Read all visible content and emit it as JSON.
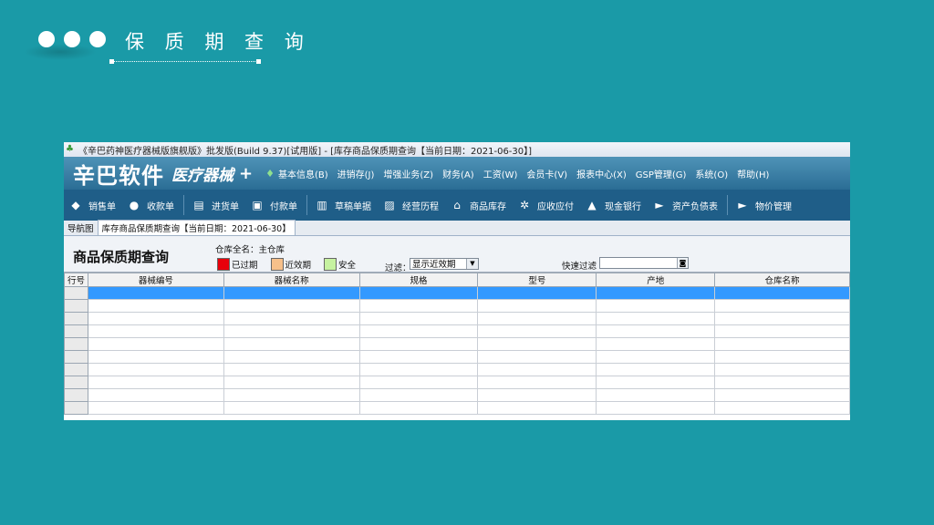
{
  "slide": {
    "title": "保 质 期 查 询"
  },
  "window": {
    "title": "《辛巴药神医疗器械版旗舰版》批发版(Build 9.37)[试用版] - [库存商品保质期查询【当前日期：2021-06-30】]"
  },
  "brand": {
    "logo": "辛巴软件",
    "subtitle": "医疗器械",
    "plus": "+"
  },
  "menu": [
    "基本信息(B)",
    "进销存(J)",
    "增强业务(Z)",
    "财务(A)",
    "工资(W)",
    "会员卡(V)",
    "报表中心(X)",
    "GSP管理(G)",
    "系统(O)",
    "帮助(H)"
  ],
  "toolbar": {
    "items": [
      {
        "label": "销售单",
        "icon": "tag-icon"
      },
      {
        "label": "收款单",
        "icon": "receipt-icon"
      },
      {
        "label": "进货单",
        "icon": "clipboard-icon"
      },
      {
        "label": "付款单",
        "icon": "payment-icon"
      },
      {
        "label": "草稿单据",
        "icon": "draft-icon"
      },
      {
        "label": "经营历程",
        "icon": "chart-icon"
      },
      {
        "label": "商品库存",
        "icon": "warehouse-icon"
      },
      {
        "label": "应收应付",
        "icon": "gears-icon"
      },
      {
        "label": "现金银行",
        "icon": "bank-icon"
      },
      {
        "label": "资产负债表",
        "icon": "truck-icon"
      },
      {
        "label": "物价管理",
        "icon": "price-icon"
      }
    ]
  },
  "tabs": [
    {
      "label": "导航图",
      "active": false
    },
    {
      "label": "库存商品保质期查询【当前日期：2021-06-30】",
      "active": true
    }
  ],
  "filters": {
    "heading": "商品保质期查询",
    "warehouse": "仓库全名：主仓库",
    "legend": [
      {
        "label": "已过期",
        "color": "#e8000b"
      },
      {
        "label": "近效期",
        "color": "#f7c08a"
      },
      {
        "label": "安全",
        "color": "#c6f2a0"
      }
    ],
    "filter_label": "过滤：",
    "filter_value": "显示近效期",
    "quick_filter_label": "快速过滤",
    "quick_filter_value": ""
  },
  "grid": {
    "columns": [
      "行号",
      "器械编号",
      "器械名称",
      "规格",
      "型号",
      "产地",
      "仓库名称"
    ],
    "selected_row": 0,
    "row_count": 10,
    "selection_color": "#3399ff"
  }
}
